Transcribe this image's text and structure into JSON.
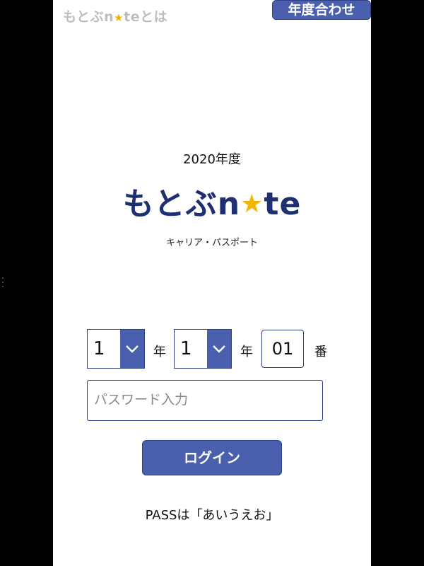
{
  "app": {
    "header_title_part1": "もとぶn",
    "header_title_part2": "teとは",
    "year_adjust_button": "年度合わせ"
  },
  "branding": {
    "fiscal_year": "2020年度",
    "logo_part1": "もとぶn",
    "logo_part2": "te",
    "subtitle": "キャリア・パスポート"
  },
  "icons": {
    "star": "star-icon",
    "chevron": "chevron-down-icon"
  },
  "form": {
    "grade_value": "1",
    "grade_unit": "年",
    "class_value": "1",
    "class_unit": "年",
    "number_value": "01",
    "number_unit": "番",
    "password_placeholder": "パスワード入力",
    "login_label": "ログイン"
  },
  "hint": "PASSは「あいうえお」",
  "colors": {
    "accent": "#4a5fae",
    "logo": "#1e2f72",
    "star": "#f2b600"
  }
}
